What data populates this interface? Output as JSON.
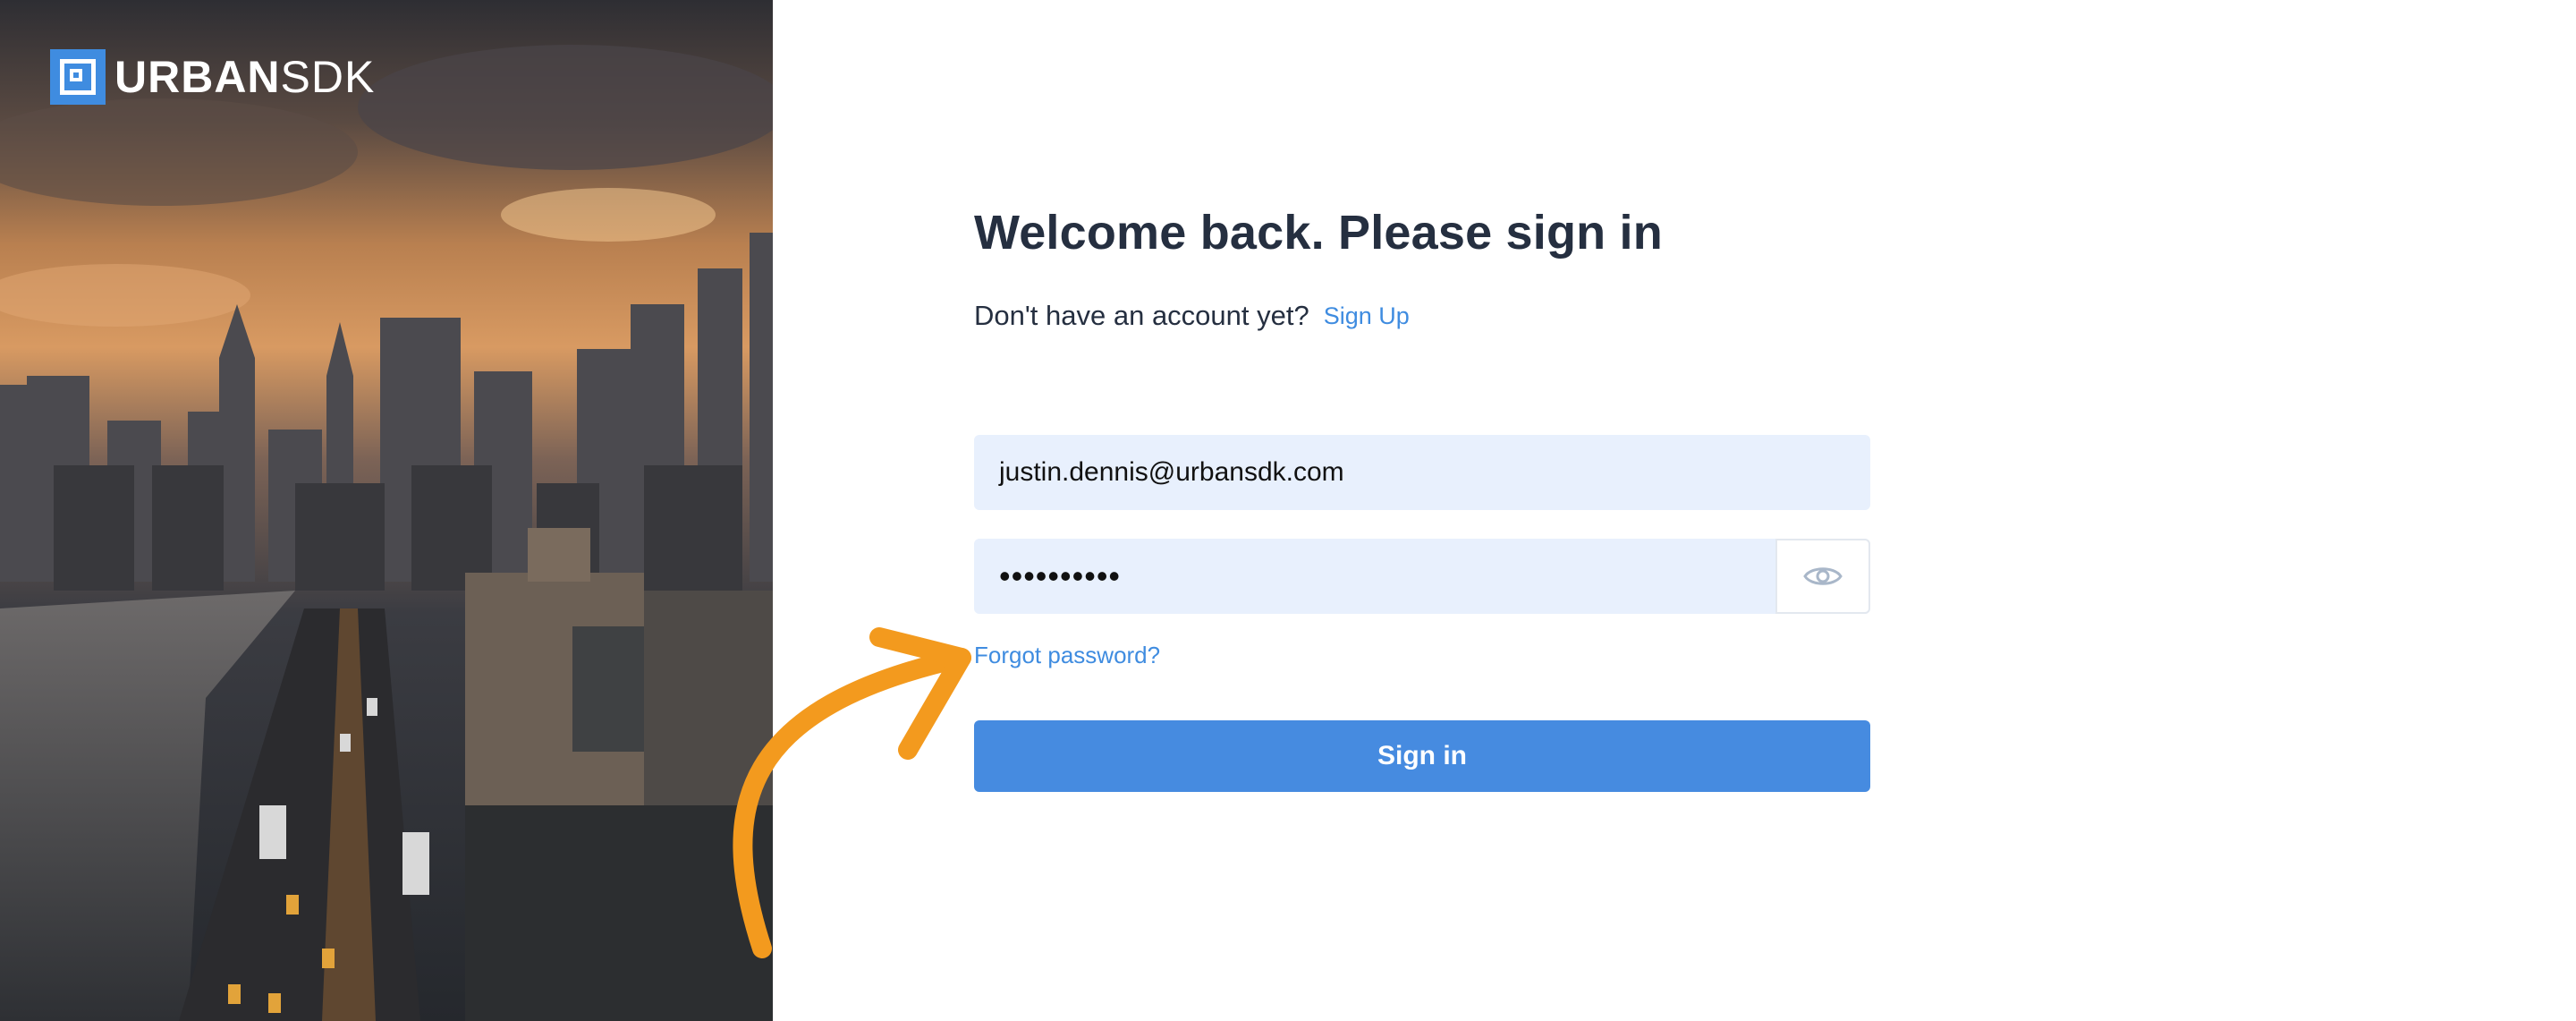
{
  "brand": {
    "name_bold": "URBAN",
    "name_light": "SDK",
    "color": "#3f8ce0"
  },
  "hero": {
    "image": "city-skyline-photo"
  },
  "form": {
    "title": "Welcome back. Please sign in",
    "signup_prompt": "Don't have an account yet?",
    "signup_link": "Sign Up",
    "email_value": "justin.dennis@urbansdk.com",
    "password_mask": "••••••••••",
    "forgot_link": "Forgot password?",
    "submit_label": "Sign in"
  },
  "annotation": {
    "arrow_color": "#f39a1e",
    "icon": "curved-arrow-icon"
  },
  "icons": {
    "password_toggle": "eye-icon"
  }
}
